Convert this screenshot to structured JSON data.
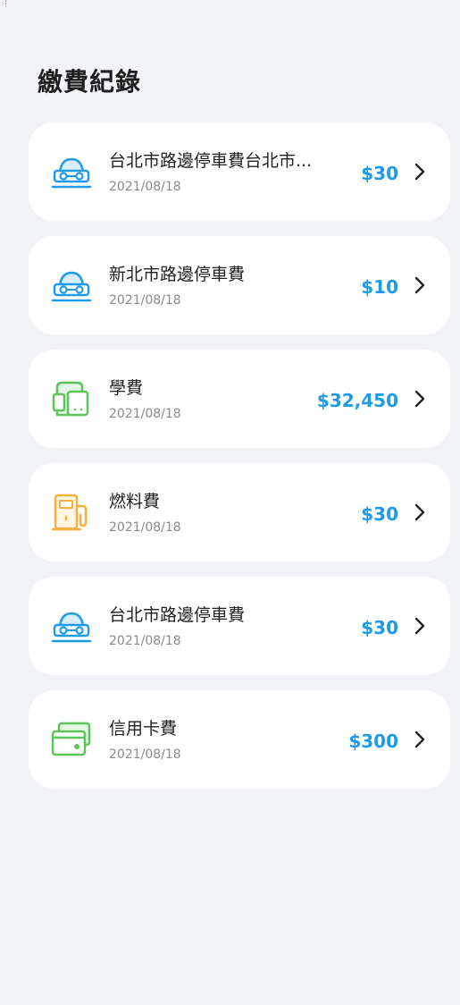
{
  "page": {
    "title": "繳費紀錄"
  },
  "records": [
    {
      "name": "台北市路邊停車費台北市...",
      "date": "2021/08/18",
      "amount": "$30",
      "icon": "car-icon",
      "icon_color": "#1e9be8"
    },
    {
      "name": "新北市路邊停車費",
      "date": "2021/08/18",
      "amount": "$10",
      "icon": "car-icon",
      "icon_color": "#1e9be8"
    },
    {
      "name": "學費",
      "date": "2021/08/18",
      "amount": "$32,450",
      "icon": "backpack-icon",
      "icon_color": "#5cc45a"
    },
    {
      "name": "燃料費",
      "date": "2021/08/18",
      "amount": "$30",
      "icon": "fuel-pump-icon",
      "icon_color": "#f5b041"
    },
    {
      "name": "台北市路邊停車費",
      "date": "2021/08/18",
      "amount": "$30",
      "icon": "car-icon",
      "icon_color": "#1e9be8"
    },
    {
      "name": "信用卡費",
      "date": "2021/08/18",
      "amount": "$300",
      "icon": "credit-card-icon",
      "icon_color": "#5cc45a"
    }
  ],
  "colors": {
    "accent": "#1e9be8",
    "background": "#f2f3f7",
    "card": "#ffffff"
  }
}
